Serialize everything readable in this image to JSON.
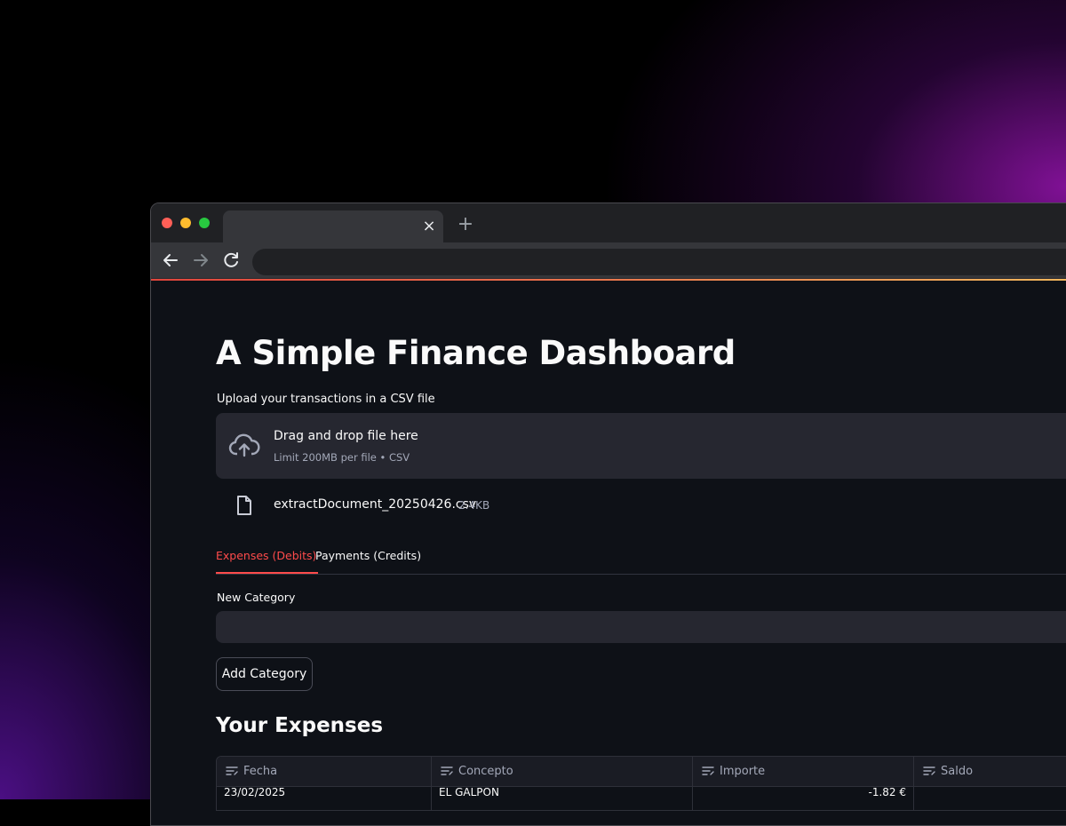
{
  "browser": {
    "tab_close": "×",
    "new_tab": "+"
  },
  "page": {
    "title": "A Simple Finance Dashboard",
    "upload": {
      "label": "Upload your transactions in a CSV file",
      "drop_text": "Drag and drop file here",
      "limit_text": "Limit 200MB per file • CSV"
    },
    "file": {
      "name": "extractDocument_20250426.csv",
      "size": "2.4KB"
    },
    "tabs": [
      {
        "label": "Expenses (Debits)",
        "active": true
      },
      {
        "label": "Payments (Credits)",
        "active": false
      }
    ],
    "new_category": {
      "label": "New Category",
      "value": ""
    },
    "add_button": "Add Category",
    "expenses_heading": "Your Expenses",
    "table": {
      "columns": [
        "Fecha",
        "Concepto",
        "Importe",
        "Saldo"
      ],
      "rows": [
        [
          "23/02/2025",
          "EL GALPON",
          "-1.82 €",
          ""
        ]
      ]
    }
  },
  "colors": {
    "accent": "#ff4b4b",
    "background": "#0e1117",
    "surface": "#262730",
    "glow": "#9614af"
  },
  "icons": [
    "back-arrow-icon",
    "forward-arrow-icon",
    "reload-icon",
    "cloud-upload-icon",
    "file-icon",
    "text-column-icon"
  ]
}
